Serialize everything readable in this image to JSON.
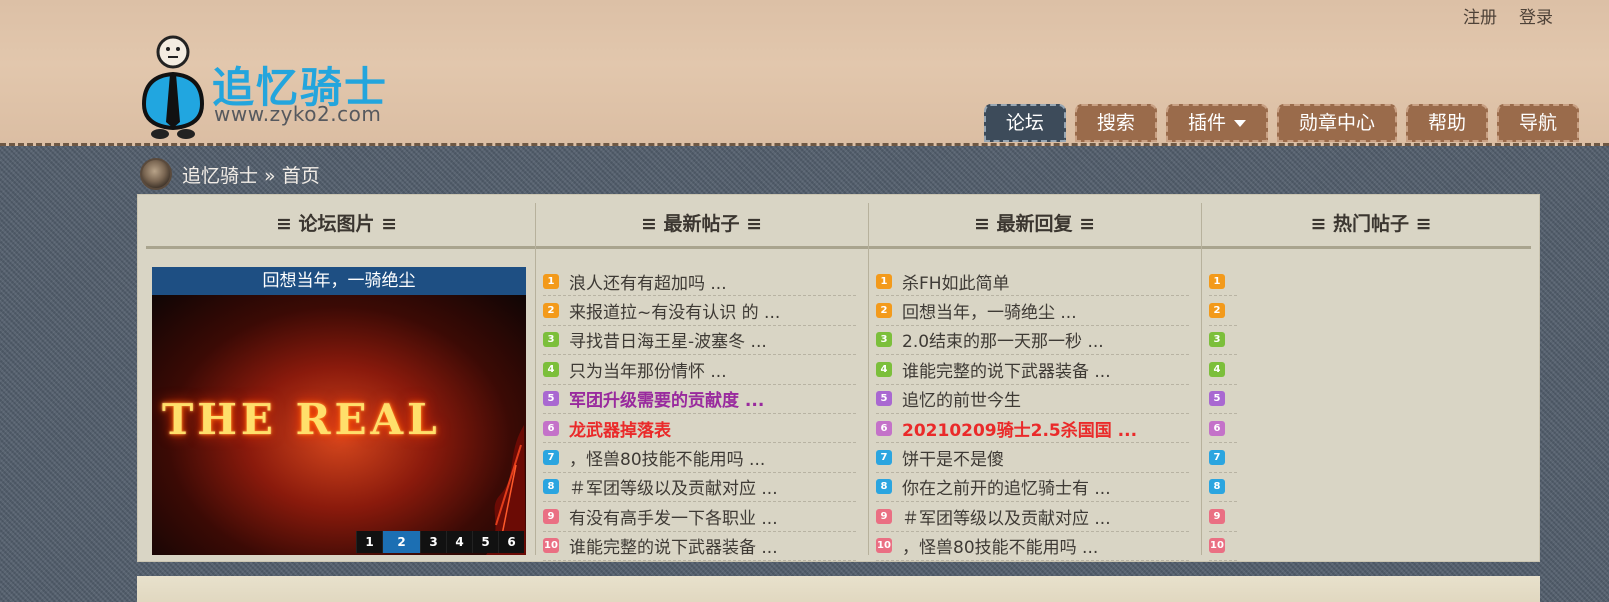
{
  "top_links": [
    "注册",
    "登录"
  ],
  "logo": {
    "title": "追忆骑士",
    "url": "www.zyko2.com"
  },
  "nav": [
    {
      "label": "论坛",
      "active": true
    },
    {
      "label": "搜索",
      "active": false
    },
    {
      "label": "插件",
      "active": false,
      "dropdown": true
    },
    {
      "label": "勋章中心",
      "active": false
    },
    {
      "label": "帮助",
      "active": false
    },
    {
      "label": "导航",
      "active": false
    }
  ],
  "breadcrumb": "追忆骑士 » 首页",
  "columns": {
    "pics": "≡ 论坛图片 ≡",
    "new_posts": "≡ 最新帖子 ≡",
    "new_replies": "≡ 最新回复 ≡",
    "hot_posts": "≡ 热门帖子 ≡"
  },
  "slideshow": {
    "caption": "回想当年，一骑绝尘",
    "image_text": "THE REAL",
    "pages": [
      "1",
      "2",
      "3",
      "4",
      "5",
      "6"
    ],
    "current_page": "2"
  },
  "new_posts": [
    "浪人还有有超加吗 ...",
    "来报道拉~有没有认识 的 ...",
    "寻找昔日海王星-波塞冬 ...",
    "只为当年那份情怀 ...",
    "军团升级需要的贡献度 ...",
    "龙武器掉落表",
    "，怪兽80技能不能用吗 ...",
    "＃军团等级以及贡献对应 ...",
    "有没有高手发一下各职业 ...",
    "谁能完整的说下武器装备 ..."
  ],
  "new_replies": [
    "杀FH如此简单",
    "回想当年，一骑绝尘 ...",
    "2.0结束的那一天那一秒 ...",
    "谁能完整的说下武器装备 ...",
    "追忆的前世今生",
    "20210209骑士2.5杀国国 ...",
    "饼干是不是傻",
    "你在之前开的追忆骑士有 ...",
    "＃军团等级以及贡献对应 ...",
    "，怪兽80技能不能用吗 ..."
  ],
  "hot_posts": [
    "",
    "",
    "",
    "",
    "",
    "",
    "",
    "",
    "",
    ""
  ],
  "rank_numbers": [
    "1",
    "2",
    "3",
    "4",
    "5",
    "6",
    "7",
    "8",
    "9",
    "10"
  ],
  "colors": {
    "rank_badges": [
      "#f39a1b",
      "#f39a1b",
      "#7cbf3b",
      "#7cbf3b",
      "#a968d1",
      "#c472c9",
      "#2ba5e0",
      "#2ba5e0",
      "#ea6f83",
      "#ea6f83"
    ],
    "highlight_purple": "#992a9e",
    "highlight_red": "#ea2a2a",
    "nav_active": "#3d4b5a",
    "nav_tab": "#9a6b4b",
    "logo_blue": "#23a5dd"
  },
  "highlights": {
    "new_posts": {
      "4": "purple",
      "5": "red"
    },
    "new_replies": {
      "5": "red"
    }
  }
}
